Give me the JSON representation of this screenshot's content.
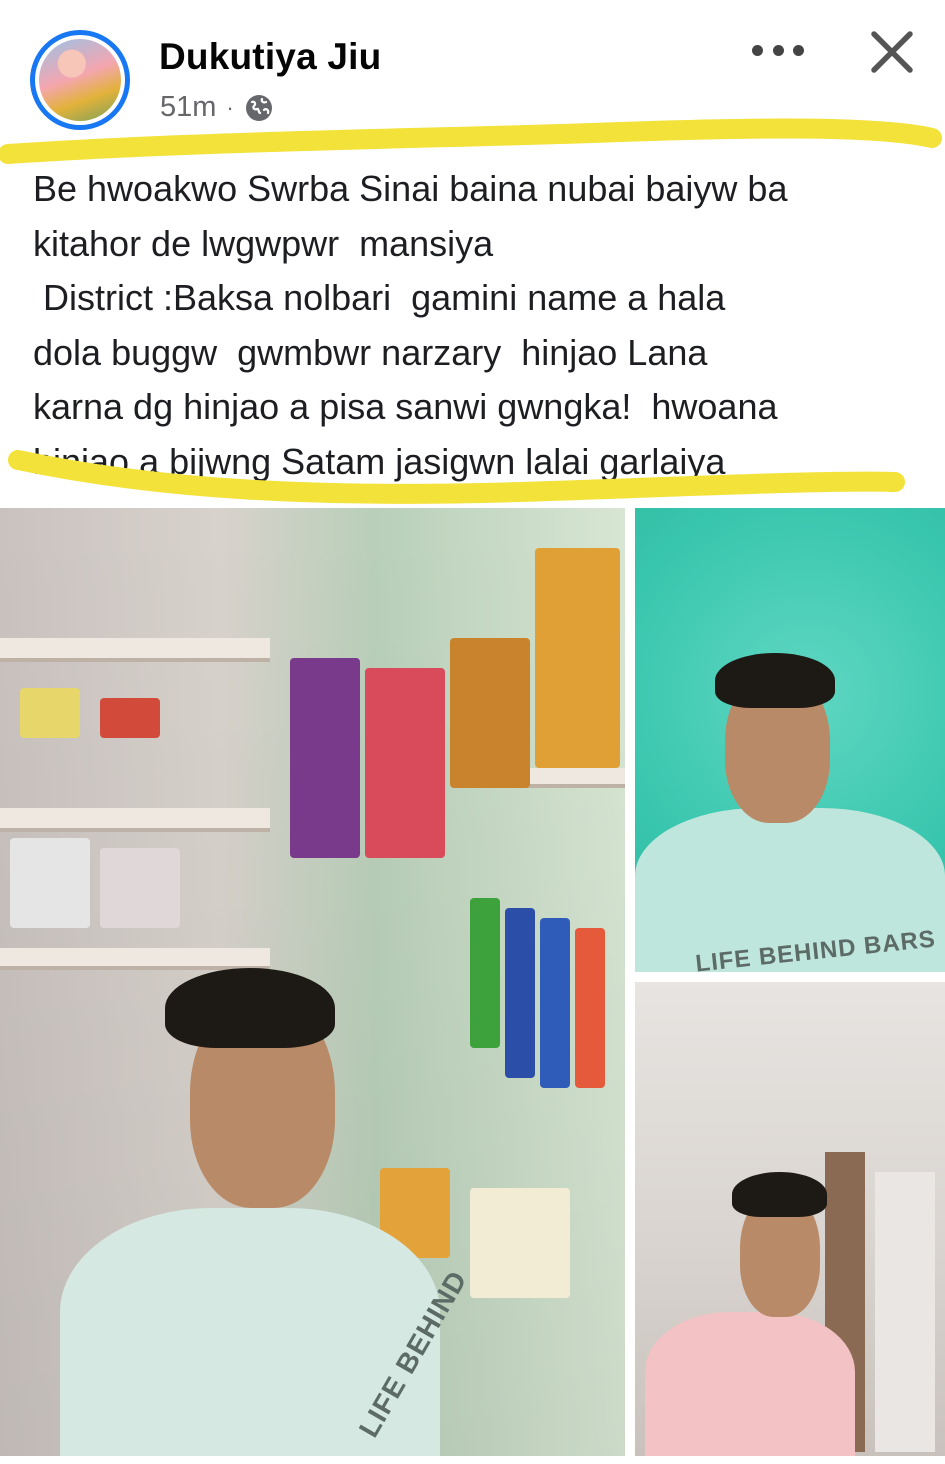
{
  "post": {
    "author_name": "Dukutiya Jiu",
    "timestamp": "51m",
    "separator": "·",
    "audience_icon": "globe-icon",
    "text": "Be hwoakwo Swrba Sinai baina nubai baiyw ba\nkitahor de lwgwpwr  mansiya\n District :Baksa nolbari  gamini name a hala\ndola buggw  gwmbwr narzary  hinjao Lana\nkarna dg hinjao a pisa sanwi gwngka!  hwoana\nhinjao a bijwng Satam jasigwn lalai garlaiya"
  },
  "controls": {
    "more_icon": "more-icon",
    "close_icon": "close-icon"
  },
  "photos": {
    "main_shirt_print": "LIFE BEHIND",
    "top_right_shirt_print": "LIFE BEHIND BARS"
  },
  "colors": {
    "highlight": "#f3e23a",
    "avatar_ring": "#1877f2",
    "meta_text": "#65676b"
  }
}
